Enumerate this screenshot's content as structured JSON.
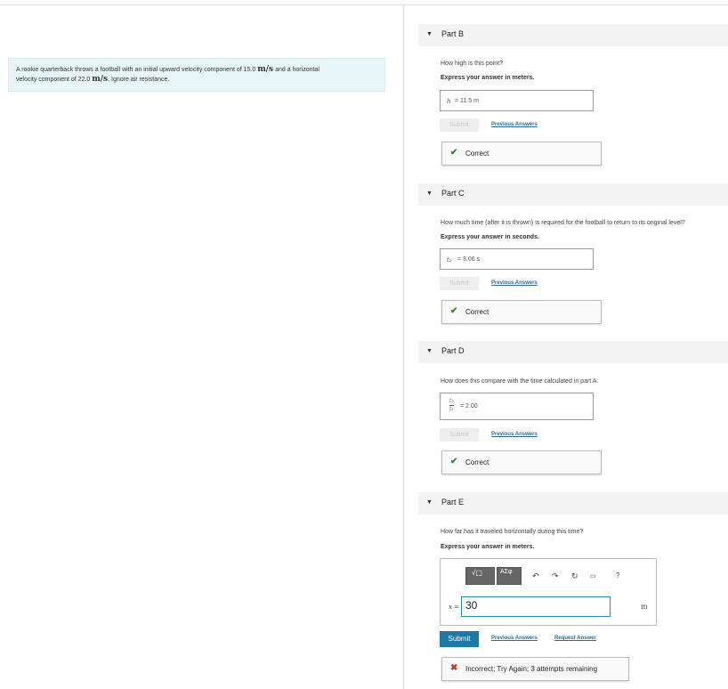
{
  "problem": {
    "text1": "A rookie quarterback throws a football with an initial upward velocity component of 15.0",
    "unit1": "m/s",
    "text2": "and a horizontal",
    "text3": "velocity component of 22.0",
    "unit2": "m/s",
    "text4": ". Ignore air resistance."
  },
  "parts": {
    "b": {
      "title": "Part B",
      "question": "How high is this point?",
      "instruction": "Express your answer in meters.",
      "label": "h",
      "answer": "= 11.5  m",
      "submit": "Submit",
      "prev": "Previous Answers",
      "status": "Correct"
    },
    "c": {
      "title": "Part C",
      "question": "How much time (after it is thrown) is required for the football to return to its original level?",
      "instruction": "Express your answer in seconds.",
      "label": "t₂",
      "answer": "= 3.06  s",
      "submit": "Submit",
      "prev": "Previous Answers",
      "status": "Correct"
    },
    "d": {
      "title": "Part D",
      "question": "How does this compare with the time calculated in part A.",
      "label_num": "t₂",
      "label_den": "t₁",
      "answer": "= 2.00",
      "submit": "Submit",
      "prev": "Previous Answers",
      "status": "Correct"
    },
    "e": {
      "title": "Part E",
      "question": "How far has it traveled horizontally during this time?",
      "instruction": "Express your answer in meters.",
      "label": "x =",
      "value": "30",
      "unit": "m",
      "submit": "Submit",
      "prev": "Previous Answers",
      "request": "Request Answer",
      "status": "Incorrect; Try Again; 3 attempts remaining",
      "toolbar_templates": "√▢",
      "toolbar_greek": "ΑΣφ",
      "help": "?"
    }
  },
  "colors": {
    "correct": "#2e8b2e",
    "incorrect": "#c0392b",
    "link": "#2b6b9e",
    "submit": "#1a7aa3"
  }
}
